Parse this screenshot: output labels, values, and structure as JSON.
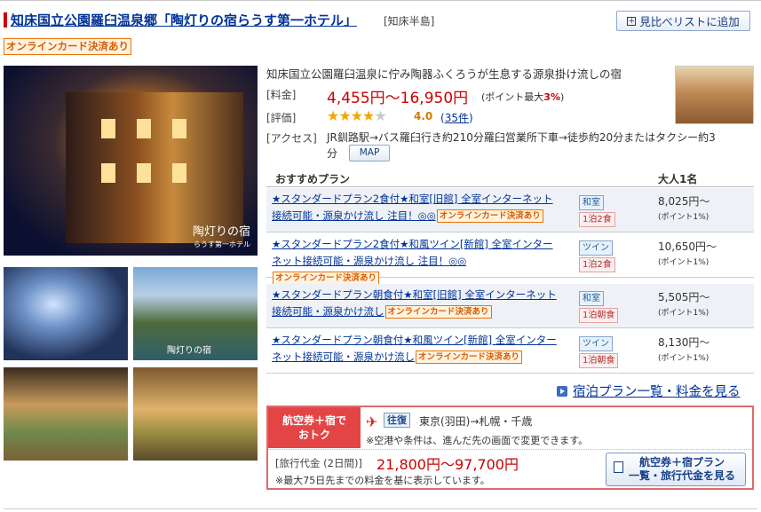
{
  "hotel": {
    "title": "知床国立公園羅臼温泉郷「陶灯りの宿らうす第一ホテル」",
    "area": "[知床半島]",
    "compare_label": "見比べリストに追加",
    "online_badge": "オンラインカード決済あり",
    "description": "知床国立公園羅臼温泉に佇み陶器ふくろうが生息する源泉掛け流しの宿",
    "price_label": "[料金]",
    "price": "4,455円～16,950円",
    "point_prefix": "(ポイント最大",
    "point_value": "3%",
    "point_suffix": ")",
    "rating_label": "[評価]",
    "rating_stars": 4,
    "rating": "4.0",
    "reviews_open": "(",
    "reviews": "35件",
    "reviews_close": ")",
    "access_label": "[アクセス]",
    "access_line1": "JR釧路駅→バス羅臼行き約210分羅臼営業所下車→徒歩約20分またはタクシー約3",
    "access_line2": "分",
    "map_label": "MAP",
    "photo_logo": "陶灯りの宿",
    "photo_logo_sub": "らうす第一ホテル"
  },
  "plans": {
    "header_plan": "おすすめプラン",
    "header_price": "大人1名",
    "items": [
      {
        "name": "★スタンダードプラン2食付★和室[旧館] 全室インターネット接続可能・源泉かけ流し 注目！◎◎",
        "badge": "オンラインカード決済あり",
        "room": "和室",
        "meal": "1泊2食",
        "price": "8,025円～",
        "point": "(ポイント1%)"
      },
      {
        "name": "★スタンダードプラン2食付★和風ツイン[新館] 全室インターネット接続可能・源泉かけ流し 注目！◎◎",
        "badge": "オンラインカード決済あり",
        "room": "ツイン",
        "meal": "1泊2食",
        "price": "10,650円～",
        "point": "(ポイント1%)"
      },
      {
        "name": "★スタンダードプラン朝食付★和室[旧館] 全室インターネット接続可能・源泉かけ流し",
        "badge": "オンラインカード決済あり",
        "room": "和室",
        "meal": "1泊朝食",
        "price": "5,505円～",
        "point": "(ポイント1%)"
      },
      {
        "name": "★スタンダードプラン朝食付★和風ツイン[新館] 全室インターネット接続可能・源泉かけ流し",
        "badge": "オンラインカード決済あり",
        "room": "ツイン",
        "meal": "1泊朝食",
        "price": "8,130円～",
        "point": "(ポイント1%)"
      }
    ],
    "list_link": "宿泊プラン一覧・料金を見る"
  },
  "air": {
    "tag_line1": "航空券＋宿で",
    "tag_line2": "おトク",
    "round_trip": "往復",
    "route": "東京(羽田)→札幌・千歳",
    "note1": "※空港や条件は、進んだ先の画面で変更できます。",
    "tour_label": "[旅行代金 (2日間)]",
    "tour_price": "21,800円～97,700円",
    "note2": "※最大75日先までの料金を基に表示しています。",
    "button_line1": "航空券＋宿プラン",
    "button_line2": "一覧・旅行代金を見る"
  },
  "colors": {
    "accent_red": "#cc0000",
    "link_blue": "#003399",
    "badge_orange": "#e8730c"
  }
}
